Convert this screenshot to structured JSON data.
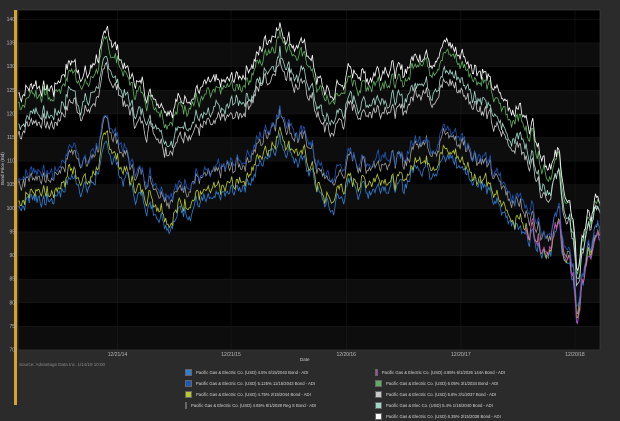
{
  "chart_data": {
    "type": "line",
    "xlabel": "Date",
    "ylabel": "Bond Price (Bid)",
    "ylim": [
      70,
      142
    ],
    "y_ticks": [
      70,
      75,
      80,
      85,
      90,
      95,
      100,
      105,
      110,
      115,
      120,
      125,
      130,
      135,
      140
    ],
    "x_ticks": [
      "12/21/14",
      "12/21/15",
      "12/20/16",
      "12/20/17",
      "12/20/18"
    ],
    "x_tick_positions": [
      0.171,
      0.366,
      0.564,
      0.761,
      0.957
    ],
    "grid": true,
    "legend_position": "bottom",
    "source": "Source: Advantage Data Inc. 1/14/19 10:00",
    "series": [
      {
        "name": "Pacific Gas & Electric Co. (USD) 4.5% 6/15/2043 Bond - ADI",
        "color": "#2f7fd6",
        "offset": -3.0,
        "crash": 2.0
      },
      {
        "name": "Pacific Gas & Electric Co. (USD) 4.95% 6/1/2026 144A Bond - ADI",
        "color": "#c040c0",
        "offset": -1.0,
        "crash": 0.0,
        "start_fraction": 0.87
      },
      {
        "name": "Pacific Gas & Electric Co. (USD) 5.125% 11/15/2043 Bond - ADI",
        "color": "#1f57b8",
        "offset": 3.0,
        "crash": 3.0
      },
      {
        "name": "Pacific Gas & Electric Co. (USD) 6.05% 3/1/2034 Bond - ADI",
        "color": "#5fae5f",
        "offset": 19.0,
        "crash": 8.0
      },
      {
        "name": "Pacific Gas & Electric Co. (USD) 4.75% 2/15/2044 Bond - ADI",
        "color": "#b8c92c",
        "offset": -1.5,
        "crash": 1.5
      },
      {
        "name": "Pacific Gas & Electric Co. (USD) 5.8% 3/1/2037 Bond - ADI",
        "color": "#c9c9c9",
        "offset": 13.0,
        "crash": 6.0
      },
      {
        "name": "Pacific Gas & Electric Co. (USD) 4.65% 8/1/2028 Reg S Bond - ADI",
        "color": "#9a9a9a",
        "offset": 2.0,
        "crash": 2.5
      },
      {
        "name": "Pacific Gas & Elec Co. (USD) 5.4% 1/15/2040 Bond - ADI",
        "color": "#9fd6c8",
        "offset": 15.0,
        "crash": 7.0
      },
      {
        "name": "Pacific Gas & Electric Co. (USD) 6.35% 2/15/2038 Bond - ADI",
        "color": "#ffffff",
        "offset": 21.0,
        "crash": 9.0
      }
    ],
    "base_path": [
      [
        0.0,
        103
      ],
      [
        0.03,
        106
      ],
      [
        0.06,
        104
      ],
      [
        0.09,
        110
      ],
      [
        0.12,
        107
      ],
      [
        0.155,
        116
      ],
      [
        0.18,
        110
      ],
      [
        0.2,
        106
      ],
      [
        0.23,
        104
      ],
      [
        0.26,
        100
      ],
      [
        0.3,
        104
      ],
      [
        0.33,
        104
      ],
      [
        0.36,
        106
      ],
      [
        0.39,
        108
      ],
      [
        0.42,
        113
      ],
      [
        0.45,
        118
      ],
      [
        0.48,
        113
      ],
      [
        0.5,
        112
      ],
      [
        0.52,
        105
      ],
      [
        0.54,
        103
      ],
      [
        0.57,
        108
      ],
      [
        0.6,
        107
      ],
      [
        0.63,
        109
      ],
      [
        0.66,
        107
      ],
      [
        0.69,
        113
      ],
      [
        0.71,
        111
      ],
      [
        0.74,
        114
      ],
      [
        0.77,
        111
      ],
      [
        0.8,
        108
      ],
      [
        0.82,
        104
      ],
      [
        0.84,
        101
      ],
      [
        0.86,
        100
      ],
      [
        0.87,
        96
      ],
      [
        0.885,
        97
      ],
      [
        0.9,
        93
      ],
      [
        0.91,
        92
      ],
      [
        0.93,
        97
      ],
      [
        0.94,
        89
      ],
      [
        0.955,
        86
      ],
      [
        0.96,
        76
      ],
      [
        0.965,
        80
      ],
      [
        0.975,
        88
      ],
      [
        0.985,
        90
      ],
      [
        0.995,
        95
      ],
      [
        1.0,
        92
      ]
    ]
  },
  "legend": [
    {
      "label": "Pacific Gas & Electric Co. (USD) 4.5% 6/15/2043 Bond - ADI",
      "color": "#2f7fd6"
    },
    {
      "label": "Pacific Gas & Electric Co. (USD) 4.95% 6/1/2026 144A Bond - ADI",
      "color": "#c040c0"
    },
    {
      "label": "Pacific Gas & Electric Co. (USD) 5.125% 11/15/2043 Bond - ADI",
      "color": "#1f57b8"
    },
    {
      "label": "Pacific Gas & Electric Co. (USD) 6.05% 3/1/2034 Bond - ADI",
      "color": "#5fae5f"
    },
    {
      "label": "Pacific Gas & Electric Co. (USD) 4.75% 2/15/2044 Bond - ADI",
      "color": "#b8c92c"
    },
    {
      "label": "Pacific Gas & Electric Co. (USD) 5.8% 3/1/2037 Bond - ADI",
      "color": "#c9c9c9"
    },
    {
      "label": "Pacific Gas & Electric Co. (USD) 4.65% 8/1/2028 Reg S Bond - ADI",
      "color": "#9a9a9a"
    },
    {
      "label": "Pacific Gas & Elec Co. (USD) 5.4% 1/15/2040 Bond - ADI",
      "color": "#9fd6c8"
    },
    {
      "label": "",
      "color": "",
      "empty": true
    },
    {
      "label": "Pacific Gas & Electric Co. (USD) 6.35% 2/15/2038 Bond - ADI",
      "color": "#ffffff"
    }
  ]
}
